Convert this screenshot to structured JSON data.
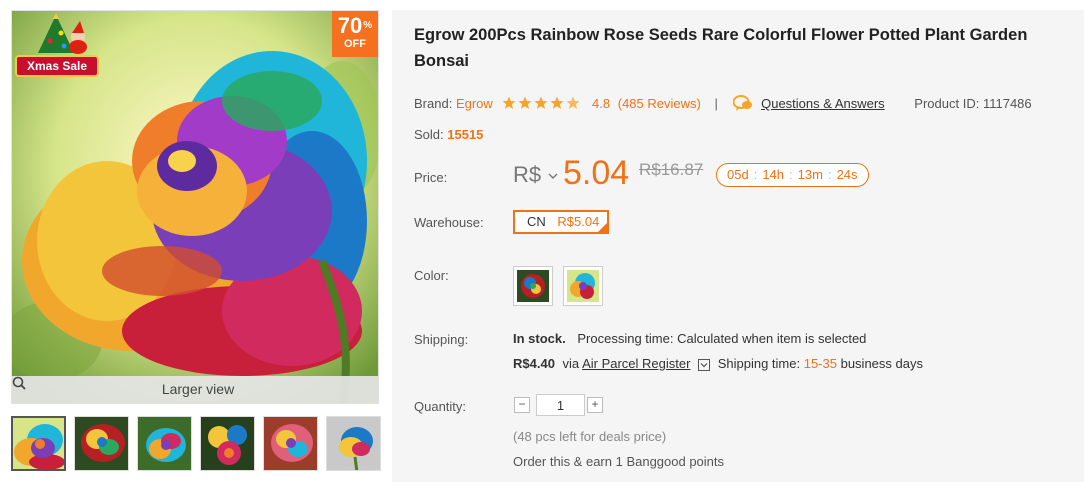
{
  "gallery": {
    "discount": {
      "percent": "70",
      "percent_sign": "%",
      "off_label": "OFF"
    },
    "xmas_badge": "Xmas Sale",
    "larger_view": "Larger view",
    "main_image_icon": "rainbow-rose-image",
    "thumbnails": [
      {
        "name": "rainbow-rose-closeup",
        "active": true
      },
      {
        "name": "red-rainbow-rose",
        "active": false
      },
      {
        "name": "rainbow-rose-green",
        "active": false
      },
      {
        "name": "rainbow-rose-bouquet",
        "active": false
      },
      {
        "name": "pink-rainbow-rose",
        "active": false
      },
      {
        "name": "rainbow-rose-side",
        "active": false
      }
    ]
  },
  "product": {
    "title": "Egrow 200Pcs Rainbow Rose Seeds Rare Colorful Flower Potted Plant Garden Bonsai",
    "brand_label": "Brand:",
    "brand": "Egrow",
    "rating": "4.8",
    "reviews": "(485 Reviews)",
    "separator": "|",
    "qa_link": "Questions & Answers",
    "product_id_label": "Product ID:",
    "product_id": "1117486",
    "sold_label": "Sold:",
    "sold": "15515"
  },
  "price": {
    "label": "Price:",
    "currency": "R$",
    "value": "5.04",
    "old": "R$16.87",
    "countdown": {
      "days": "05d",
      "hours": "14h",
      "minutes": "13m",
      "seconds": "24s"
    }
  },
  "warehouse": {
    "label": "Warehouse:",
    "code": "CN",
    "price": "R$5.04"
  },
  "color": {
    "label": "Color:",
    "options": [
      "rainbow-rose-dark",
      "rainbow-rose-light"
    ]
  },
  "shipping": {
    "label": "Shipping:",
    "stock": "In stock.",
    "processing_label": "Processing time:",
    "processing_value": "Calculated when item is selected",
    "cost": "R$4.40",
    "via": "via",
    "method": "Air Parcel Register",
    "time_label": "Shipping time:",
    "time_range": "15-35",
    "time_unit": "business days"
  },
  "quantity": {
    "label": "Quantity:",
    "minus": "−",
    "plus": "+",
    "value": "1",
    "note": "(48 pcs left for deals price)",
    "points": "Order this & earn 1 Banggood points"
  },
  "colors": {
    "accent": "#f07216",
    "badge": "#f5701f",
    "panel_bg": "#f5f5f5"
  }
}
